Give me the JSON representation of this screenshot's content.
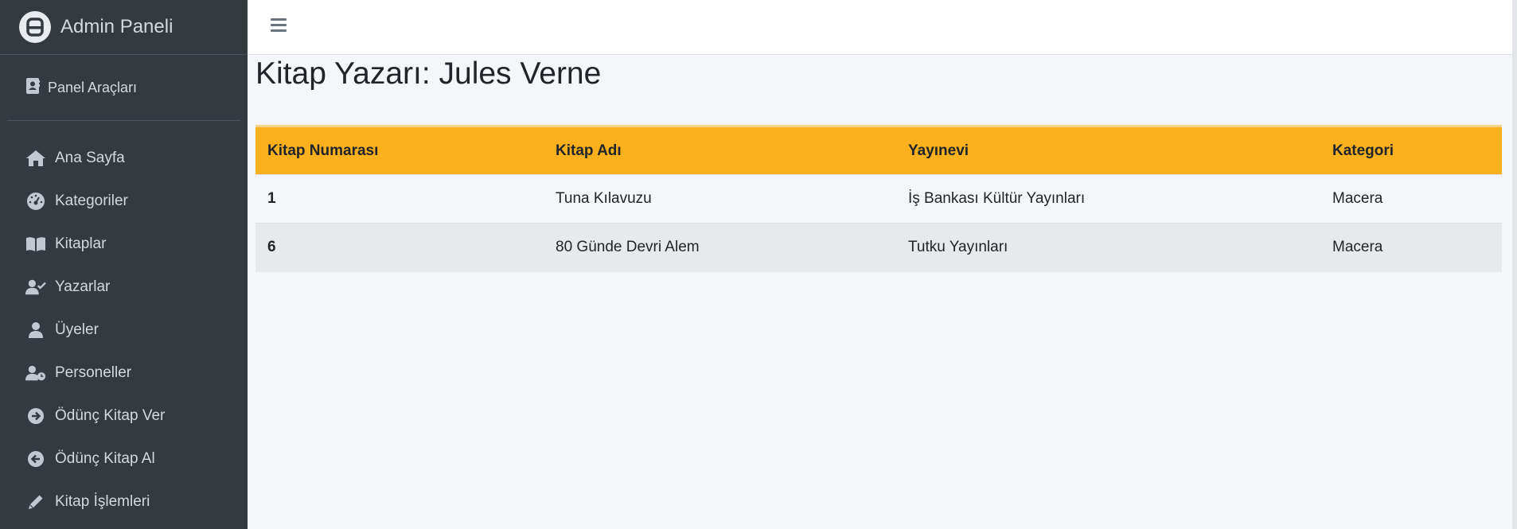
{
  "sidebar": {
    "brand": {
      "logo_letter": "A",
      "title": "Admin Paneli"
    },
    "panel_tools": {
      "label": "Panel Araçları",
      "icon": "address-book-icon"
    },
    "items": [
      {
        "label": "Ana Sayfa",
        "icon": "home-icon"
      },
      {
        "label": "Kategoriler",
        "icon": "gauge-icon"
      },
      {
        "label": "Kitaplar",
        "icon": "book-open-icon"
      },
      {
        "label": "Yazarlar",
        "icon": "user-check-icon"
      },
      {
        "label": "Üyeler",
        "icon": "user-icon"
      },
      {
        "label": "Personeller",
        "icon": "user-clock-icon"
      },
      {
        "label": "Ödünç Kitap Ver",
        "icon": "arrow-circle-right-icon"
      },
      {
        "label": "Ödünç Kitap Al",
        "icon": "arrow-circle-left-icon"
      },
      {
        "label": "Kitap İşlemleri",
        "icon": "pencil-icon"
      }
    ]
  },
  "topbar": {
    "menu_icon": "hamburger-icon"
  },
  "main": {
    "title": "Kitap Yazarı: Jules Verne",
    "table": {
      "headers": [
        "Kitap Numarası",
        "Kitap Adı",
        "Yayınevi",
        "Kategori"
      ],
      "rows": [
        [
          "1",
          "Tuna Kılavuzu",
          "İş Bankası Kültür Yayınları",
          "Macera"
        ],
        [
          "6",
          "80 Günde Devri Alem",
          "Tutku Yayınları",
          "Macera"
        ]
      ]
    }
  },
  "colors": {
    "sidebar_bg": "#343a40",
    "header_accent": "#fbb11d",
    "content_bg": "#f4f6f9"
  }
}
